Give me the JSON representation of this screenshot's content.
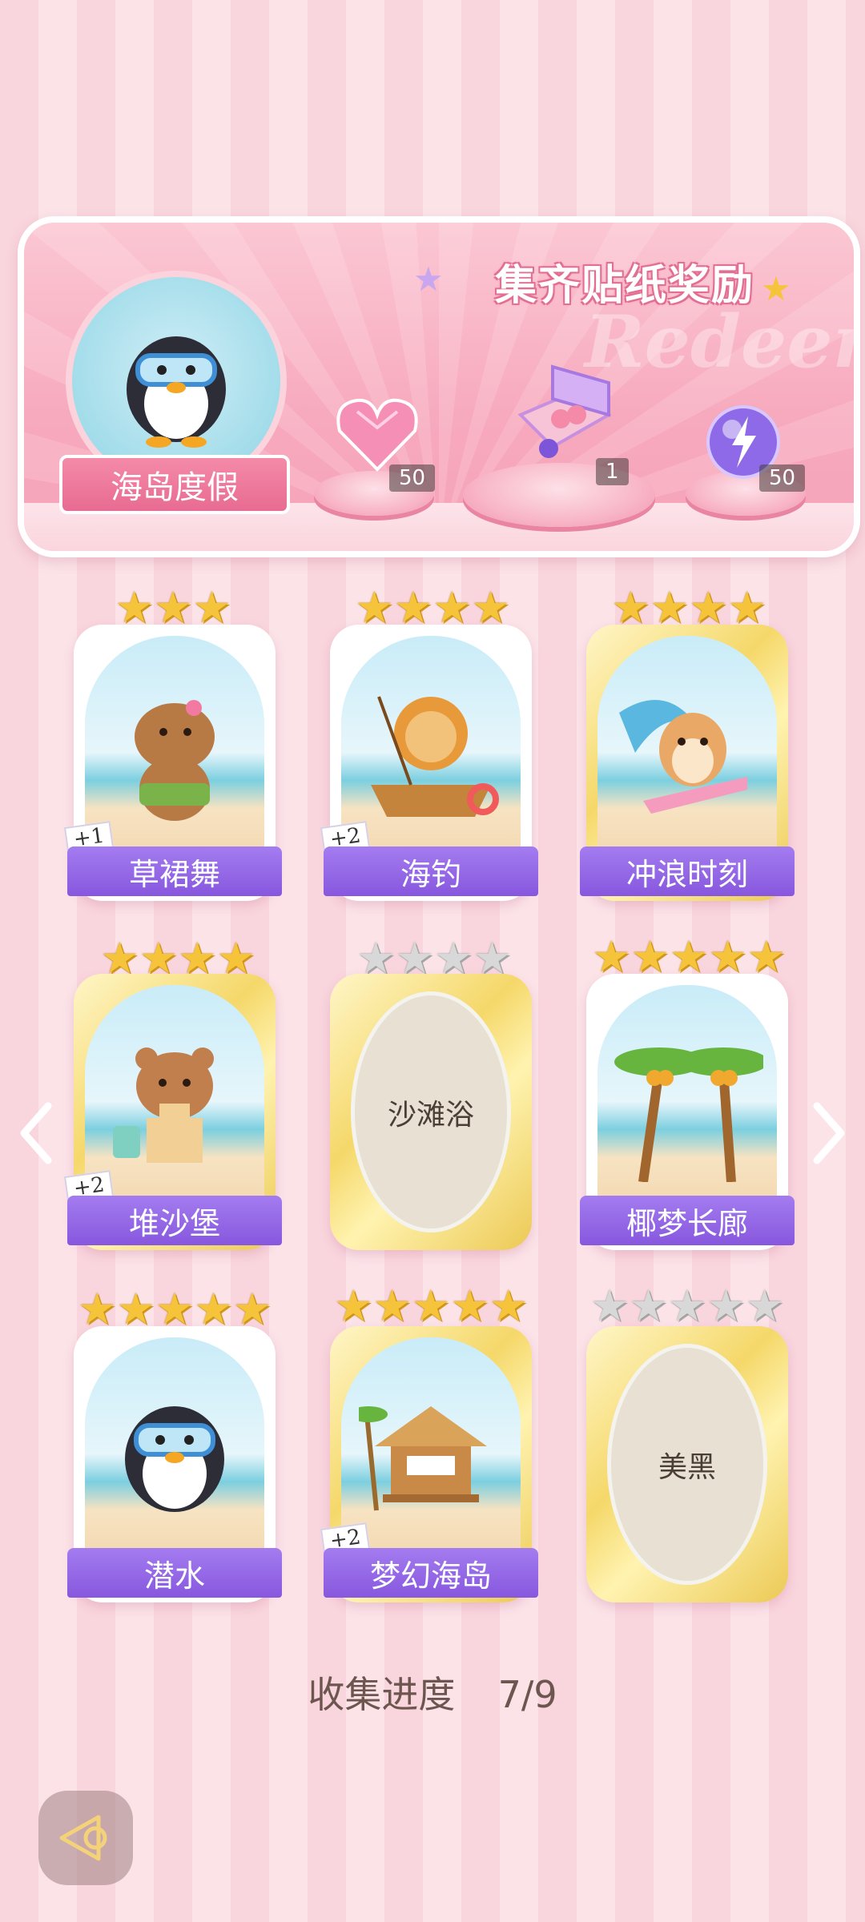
{
  "banner": {
    "title": "集齐贴纸奖励",
    "watermark": "Redeem",
    "album_name": "海岛度假",
    "rewards": [
      {
        "icon": "pink-heart-gem-icon",
        "count": "50"
      },
      {
        "icon": "gift-box-icon",
        "count": "1"
      },
      {
        "icon": "lightning-orb-icon",
        "count": "50"
      }
    ]
  },
  "cards": [
    {
      "name": "草裙舞",
      "stars": 3,
      "collected": true,
      "extra": "+1",
      "icon": "capybara-hula-icon"
    },
    {
      "name": "海钓",
      "stars": 4,
      "collected": true,
      "extra": "+2",
      "icon": "lion-fishing-icon"
    },
    {
      "name": "冲浪时刻",
      "stars": 4,
      "collected": true,
      "extra": "",
      "icon": "hamster-surfing-icon"
    },
    {
      "name": "堆沙堡",
      "stars": 4,
      "collected": true,
      "extra": "+2",
      "icon": "bear-sandcastle-icon"
    },
    {
      "name": "沙滩浴",
      "stars": 4,
      "collected": false,
      "extra": "",
      "icon": ""
    },
    {
      "name": "椰梦长廊",
      "stars": 5,
      "collected": true,
      "extra": "",
      "icon": "palm-trees-icon"
    },
    {
      "name": "潜水",
      "stars": 5,
      "collected": true,
      "extra": "",
      "icon": "penguin-diving-icon"
    },
    {
      "name": "梦幻海岛",
      "stars": 5,
      "collected": true,
      "extra": "+2",
      "icon": "beach-hut-icon"
    },
    {
      "name": "美黑",
      "stars": 5,
      "collected": false,
      "extra": "",
      "icon": ""
    }
  ],
  "progress": {
    "label": "收集进度",
    "value": "7/9"
  },
  "nav": {
    "prev_icon": "chevron-left-icon",
    "next_icon": "chevron-right-icon",
    "back_icon": "back-arrow-icon"
  }
}
